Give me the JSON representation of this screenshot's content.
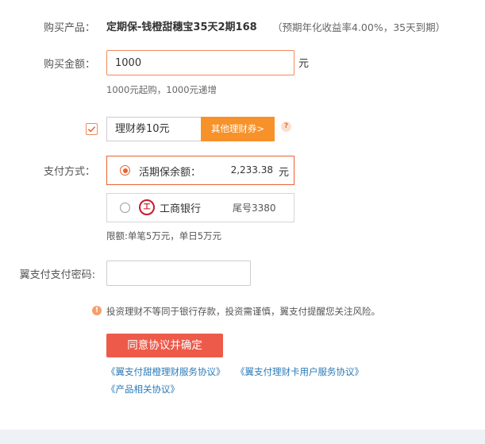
{
  "product": {
    "label": "购买产品：",
    "name": "定期保-钱橙甜穗宝35天2期168",
    "note": "（预期年化收益率4.00%，35天到期）"
  },
  "amount": {
    "label": "购买金额：",
    "value": "1000",
    "unit": "元",
    "hint": "1000元起购，1000元递增"
  },
  "coupon": {
    "checked": true,
    "value": "理财券10元",
    "other_button": "其他理财券>",
    "help_icon": "question-icon"
  },
  "payment": {
    "label": "支付方式：",
    "options": [
      {
        "name": "活期保余额：",
        "amount": "2,233.38",
        "unit": "元",
        "selected": true
      },
      {
        "name": "工商银行",
        "tail": "尾号3380",
        "icon": "icbc-logo-icon",
        "selected": false
      }
    ],
    "limit": "限额:单笔5万元，单日5万元"
  },
  "password": {
    "label": "翼支付支付密码:",
    "value": ""
  },
  "warning": {
    "icon": "warning-icon",
    "text": "投资理财不等同于银行存款，投资需谨慎，翼支付提醒您关注风险。"
  },
  "confirm_button": "同意协议并确定",
  "links": [
    "《翼支付甜橙理财服务协议》",
    "《翼支付理财卡用户服务协议》",
    "《产品相关协议》"
  ],
  "colors": {
    "accent": "#e9632f",
    "coupon_button": "#f7922a",
    "confirm_button": "#ed5a4a",
    "link": "#2a7ab8"
  }
}
